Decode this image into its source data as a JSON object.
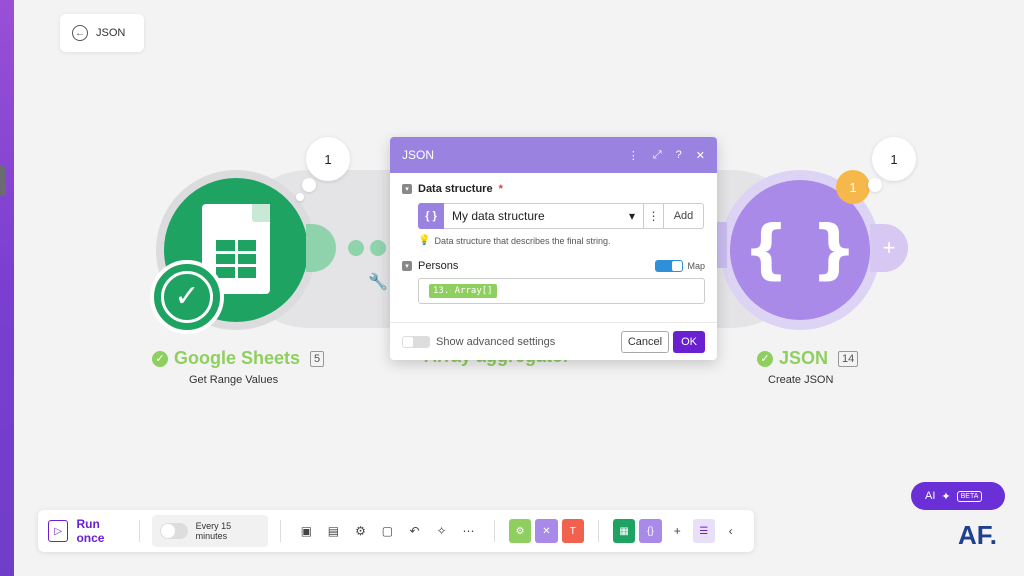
{
  "back": {
    "label": "JSON"
  },
  "modules": {
    "sheets": {
      "title": "Google Sheets",
      "count": "5",
      "subtitle": "Get Range Values",
      "bubble": "1"
    },
    "aggregator": {
      "title": "Array aggregator"
    },
    "json": {
      "title": "JSON",
      "count": "14",
      "subtitle": "Create JSON",
      "bubble": "1",
      "badge": "1"
    }
  },
  "dialog": {
    "title": "JSON",
    "data_structure_label": "Data structure",
    "data_structure_value": "My data structure",
    "add_label": "Add",
    "hint": "Data structure that describes the final string.",
    "persons_label": "Persons",
    "map_label": "Map",
    "persons_value": "13. Array[]",
    "advanced_label": "Show advanced settings",
    "cancel_label": "Cancel",
    "ok_label": "OK"
  },
  "toolbar": {
    "run_label": "Run once",
    "schedule_label": "Every 15 minutes"
  },
  "ai": {
    "label": "AI",
    "beta": "BETA"
  },
  "logo": "AF.",
  "colors": {
    "accent": "#6a1fd0",
    "sheets_green": "#1ea362",
    "json_purple": "#a98ae8",
    "success_green": "#8fcf5f"
  }
}
